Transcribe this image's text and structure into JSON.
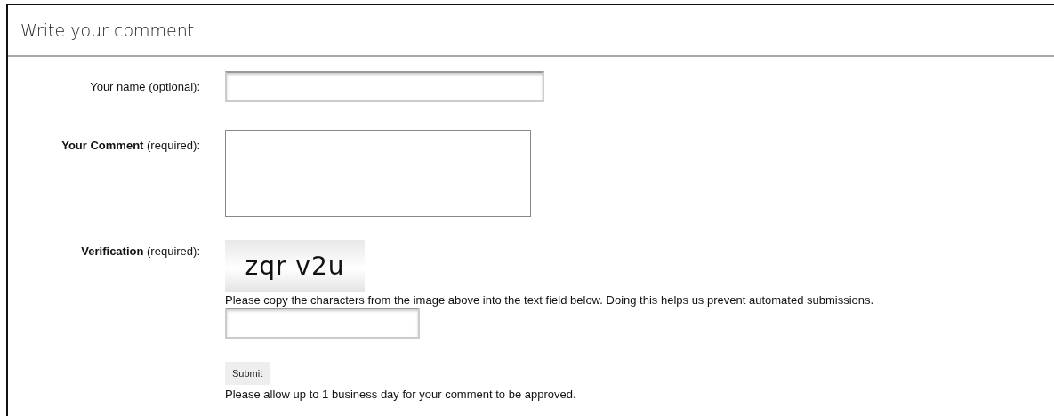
{
  "header": {
    "title": "Write your comment"
  },
  "fields": [
    {
      "kind": "text",
      "label": "Your name (optional):"
    },
    {
      "kind": "textarea",
      "label": "**Your Comment** (required):"
    },
    {
      "kind": "captcha",
      "label": "**Verification** (required):",
      "captcha_text": "zqr v2u",
      "instructions": "Please copy the characters from the image above into the text field below. Doing this helps us prevent automated submissions."
    }
  ],
  "submit": {
    "label": "Submit"
  },
  "note": "Please allow up to 1 business day for your comment to be approved."
}
